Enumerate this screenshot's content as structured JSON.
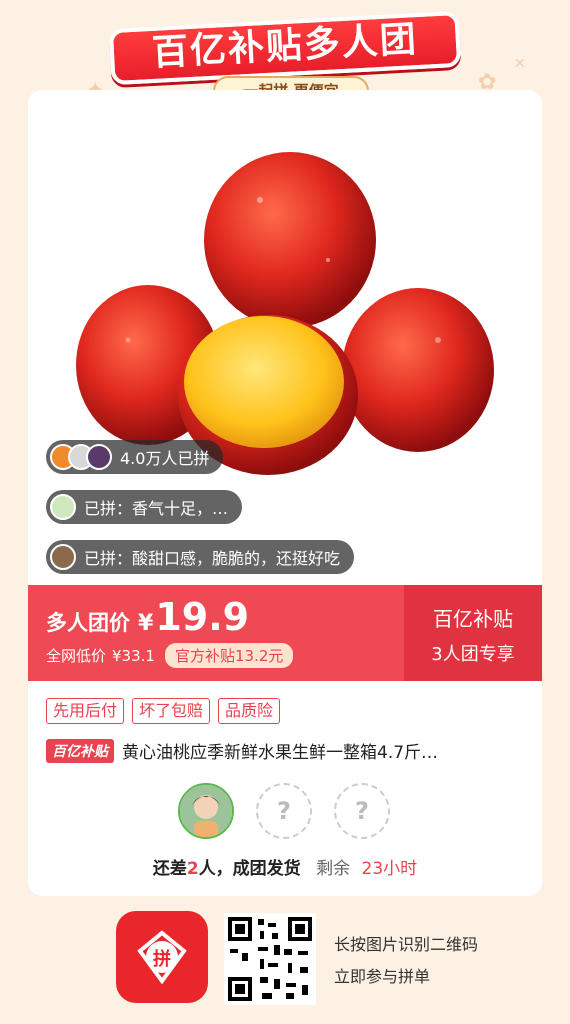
{
  "banner": {
    "title": "百亿补贴多人团",
    "subtitle": "一起拼 更便宜"
  },
  "social": {
    "join_count": "4.0万人已拼",
    "review_1": "已拼：香气十足，…",
    "review_2": "已拼：酸甜口感，脆脆的，还挺好吃"
  },
  "price": {
    "label": "多人团价",
    "currency": "¥",
    "value": "19.9",
    "original_label": "全网低价",
    "original_price": "¥33.1",
    "subsidy": "官方补贴13.2元",
    "right_title": "百亿补贴",
    "right_sub": "3人团专享"
  },
  "tags": [
    "先用后付",
    "坏了包赔",
    "品质险"
  ],
  "product": {
    "badge": "百亿补贴",
    "title": "黄心油桃应季新鲜水果生鲜一整箱4.7斤…"
  },
  "group": {
    "slot_placeholder": "?",
    "status_prefix": "还差",
    "remaining_people": "2",
    "status_suffix": "人，成团发货",
    "time_label": "剩余",
    "time_left": "23小时"
  },
  "footer": {
    "logo_text": "拼",
    "line1": "长按图片识别二维码",
    "line2": "立即参与拼单"
  },
  "colors": {
    "brand_red": "#e8434e",
    "band_red": "#ef4a54",
    "background": "#fdf1e4"
  }
}
